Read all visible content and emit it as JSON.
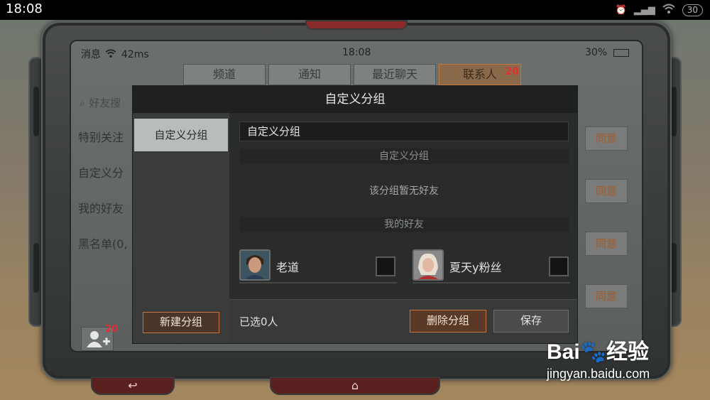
{
  "phone_status": {
    "time": "18:08",
    "battery": "30"
  },
  "game_status": {
    "messages": "消息",
    "ping": "42ms",
    "time": "18:08",
    "battery": "30%"
  },
  "tabs": [
    {
      "label": "频道"
    },
    {
      "label": "通知"
    },
    {
      "label": "最近聊天"
    },
    {
      "label": "联系人",
      "badge": "20",
      "active": true
    }
  ],
  "background": {
    "search_placeholder": "好友搜",
    "left_items": [
      "特别关注",
      "自定义分",
      "我的好友",
      "黑名单(0,"
    ],
    "agree_label": "同意",
    "add_friend_badge": "20"
  },
  "modal": {
    "title": "自定义分组",
    "left_selected": "自定义分组",
    "new_group_label": "新建分组",
    "group_name_value": "自定义分组",
    "section_custom": "自定义分组",
    "empty_text": "该分组暂无好友",
    "section_friends": "我的好友",
    "friends": [
      {
        "name": "老道",
        "checked": false
      },
      {
        "name": "夏天y粉丝",
        "checked": false
      }
    ],
    "selected_count": "已选0人",
    "delete_label": "删除分组",
    "save_label": "保存"
  },
  "watermark": {
    "logo": "Bai🐾经验",
    "url": "jingyan.baidu.com"
  }
}
